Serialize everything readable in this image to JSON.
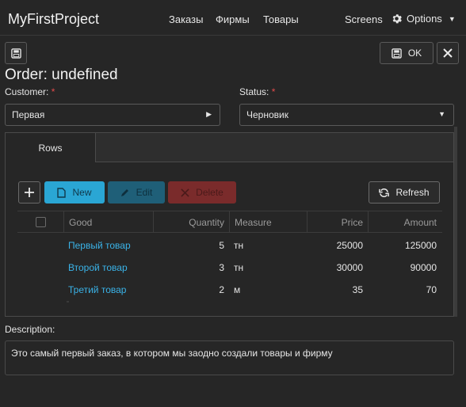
{
  "nav": {
    "brand": "MyFirstProject",
    "links": [
      "Заказы",
      "Фирмы",
      "Товары"
    ],
    "screens": "Screens",
    "options": "Options"
  },
  "toolbar": {
    "ok_label": "OK"
  },
  "page": {
    "title": "Order: undefined"
  },
  "customer": {
    "label": "Customer:",
    "required": "*",
    "value": "Первая"
  },
  "status": {
    "label": "Status:",
    "required": "*",
    "value": "Черновик"
  },
  "tabs": [
    {
      "label": "Rows"
    }
  ],
  "grid_toolbar": {
    "new_label": "New",
    "edit_label": "Edit",
    "delete_label": "Delete",
    "refresh_label": "Refresh"
  },
  "grid": {
    "columns": [
      "Good",
      "Quantity",
      "Measure",
      "Price",
      "Amount"
    ],
    "rows": [
      {
        "good": "Первый товар",
        "quantity": "5",
        "measure": "тн",
        "price": "25000",
        "amount": "125000"
      },
      {
        "good": "Второй товар",
        "quantity": "3",
        "measure": "тн",
        "price": "30000",
        "amount": "90000"
      },
      {
        "good": "Третий товар",
        "quantity": "2",
        "measure": "м",
        "price": "35",
        "amount": "70"
      }
    ]
  },
  "description": {
    "label": "Description:",
    "value": "Это самый первый заказ, в котором мы заодно создали товары и фирму"
  },
  "colors": {
    "background": "#262626",
    "accent": "#2aa6d4",
    "link": "#3ab3e8",
    "danger": "#7a2b2b"
  }
}
